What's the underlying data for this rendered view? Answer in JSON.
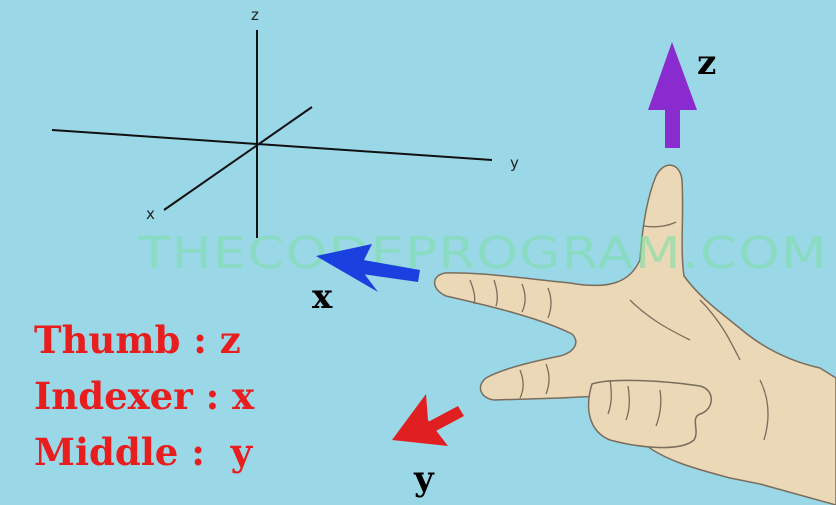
{
  "axes_diagram": {
    "z_label": "z",
    "y_label": "y",
    "x_label": "x"
  },
  "hand_arrows": {
    "z_label": "z",
    "x_label": "x",
    "y_label": "y",
    "z_color": "#8a2bd0",
    "x_color": "#1a40e0",
    "y_color": "#e02020"
  },
  "watermark": "THECODEPROGRAM.COM",
  "legend": {
    "thumb": "Thumb : z",
    "index": "Indexer : x",
    "middle": "Middle :  y"
  },
  "colors": {
    "background": "#9ad8e8",
    "legend_text": "#e81d1d",
    "hand_fill": "#ead8b6"
  }
}
